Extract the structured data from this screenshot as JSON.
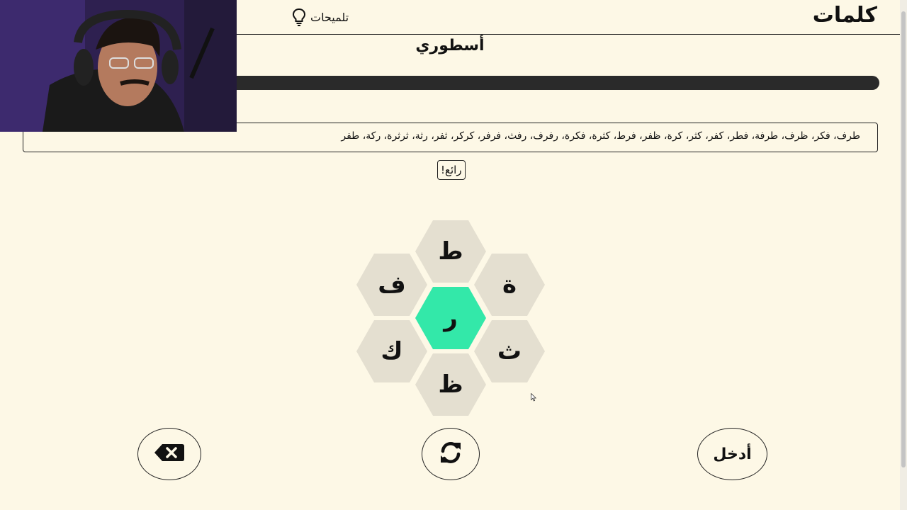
{
  "header": {
    "logo": "كلمات",
    "hints_label": "تلميحات"
  },
  "rank": "أسطوري",
  "progress": {
    "fraction": 1.0
  },
  "found_words": "طرف، فكر، ظرف، طرفة، فطر، كفر، كثر، كرة، ظفر، فرط، كثرة، فكرة، رفرف، رفث، فرفر، كركر، ثفر، رثة، ثرثرة، ركة، طفر",
  "toast": "رائع!",
  "letters": {
    "center": "ر",
    "outer": [
      "ط",
      "ة",
      "ث",
      "ظ",
      "ك",
      "ف"
    ]
  },
  "buttons": {
    "enter": "أدخل"
  },
  "colors": {
    "background": "#fdf8e6",
    "center_hex": "#33e8a9",
    "outer_hex": "#e4dfd0"
  }
}
